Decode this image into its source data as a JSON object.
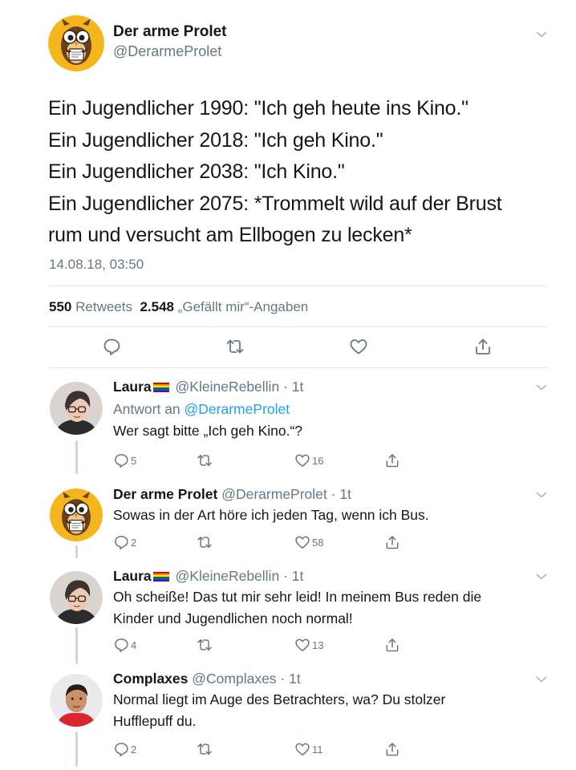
{
  "main": {
    "author_name": "Der arme Prolet",
    "author_handle": "@DerarmeProlet",
    "text_lines": [
      "Ein Jugendlicher 1990: \"Ich geh heute ins Kino.\"",
      "Ein Jugendlicher 2018: \"Ich geh Kino.\"",
      "Ein Jugendlicher 2038: \"Ich Kino.\"",
      "Ein Jugendlicher 2075: *Trommelt wild auf der Brust",
      "rum und versucht am Ellbogen zu lecken*"
    ],
    "timestamp": "14.08.18, 03:50",
    "retweets_count": "550",
    "retweets_label": "Retweets",
    "likes_count": "2.548",
    "likes_label": "„Gefällt mir“-Angaben",
    "icons": [
      "reply-icon",
      "retweet-icon",
      "like-icon",
      "share-icon"
    ]
  },
  "replies": [
    {
      "name": "Laura",
      "flag": "rainbow-flag",
      "meta": "@KleineRebellin · 1t",
      "reply_label": "Antwort an",
      "reply_mention": "@DerarmeProlet",
      "text_lines": [
        "Wer sagt bitte „Ich geh Kino.“?"
      ],
      "reply_count": "5",
      "like_count": "16"
    },
    {
      "name": "Der arme Prolet",
      "meta": "@DerarmeProlet · 1t",
      "text_lines": [
        "Sowas in der Art höre ich jeden Tag, wenn ich Bus."
      ],
      "reply_count": "2",
      "like_count": "58"
    },
    {
      "name": "Laura",
      "flag": "rainbow-flag",
      "meta": "@KleineRebellin · 1t",
      "text_lines": [
        "Oh scheiße! Das tut mir sehr leid! In meinem Bus reden die",
        "Kinder und Jugendlichen noch normal!"
      ],
      "reply_count": "4",
      "like_count": "13"
    },
    {
      "name": "Complaxes",
      "meta": "@Complaxes · 1t",
      "text_lines": [
        "Normal liegt im Auge des Betrachters, wa? Du stolzer",
        "Hufflepuff du."
      ],
      "reply_count": "2",
      "like_count": "11"
    }
  ],
  "colors": {
    "text": "#14171a",
    "secondary": "#657786",
    "link": "#1da1f2",
    "divider": "#e1e8ed",
    "thread_line": "#ccd6dd",
    "owl_bg": "#f5b51c"
  }
}
